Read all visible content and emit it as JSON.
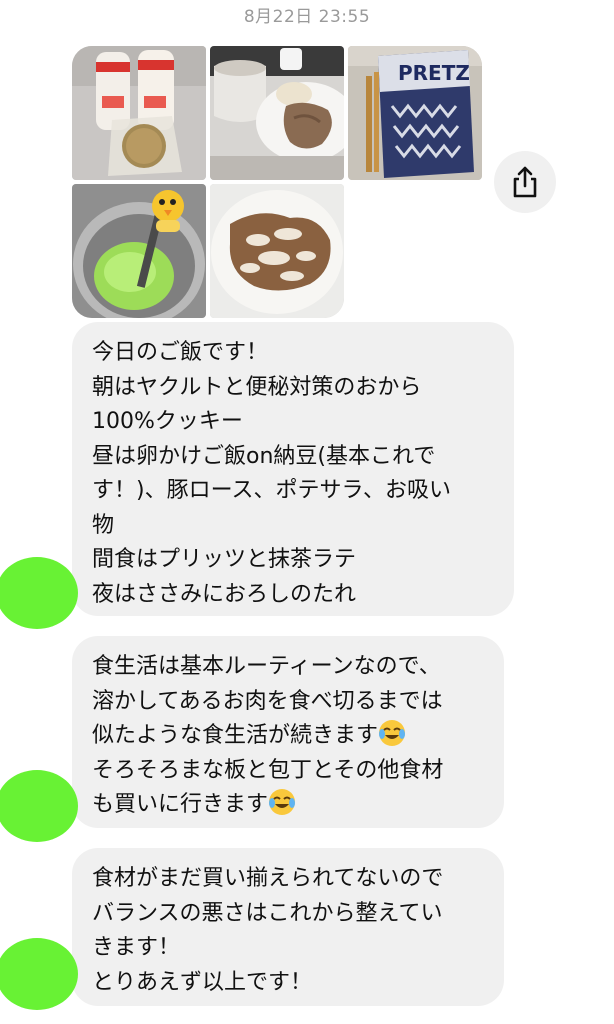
{
  "header": {
    "timestamp": "8月22日 23:55"
  },
  "photos": [
    {
      "name": "yakult-and-okara-cookies"
    },
    {
      "name": "pork-loin-and-potato-salad"
    },
    {
      "name": "pretz-snack-box"
    },
    {
      "name": "matcha-latte"
    },
    {
      "name": "chicken-with-grated-radish-sauce"
    }
  ],
  "actions": {
    "share_icon": "share-icon"
  },
  "messages": [
    {
      "lines": [
        "今日のご飯です！",
        "朝はヤクルトと便秘対策のおから",
        "100%クッキー",
        "昼は卵かけご飯on納豆(基本これで",
        "す！)、豚ロース、ポテサラ、お吸い",
        "物",
        "間食はプリッツと抹茶ラテ",
        "夜はささみにおろしのたれ"
      ]
    },
    {
      "lines": [
        "食生活は基本ルーティーンなので、",
        "溶かしてあるお肉を食べ切るまでは",
        "似たような食生活が続きます",
        "そろそろまな板と包丁とその他食材",
        "も買いに行きます"
      ],
      "emoji": "face-with-tears-of-joy"
    },
    {
      "lines": [
        "食材がまだ買い揃えられてないので",
        "バランスの悪さはこれから整えてい",
        "きます！",
        "とりあえず以上です！"
      ]
    }
  ],
  "colors": {
    "avatar": "#68f234",
    "bubble": "#f0f0f0",
    "timestamp": "#9a9a9a"
  }
}
